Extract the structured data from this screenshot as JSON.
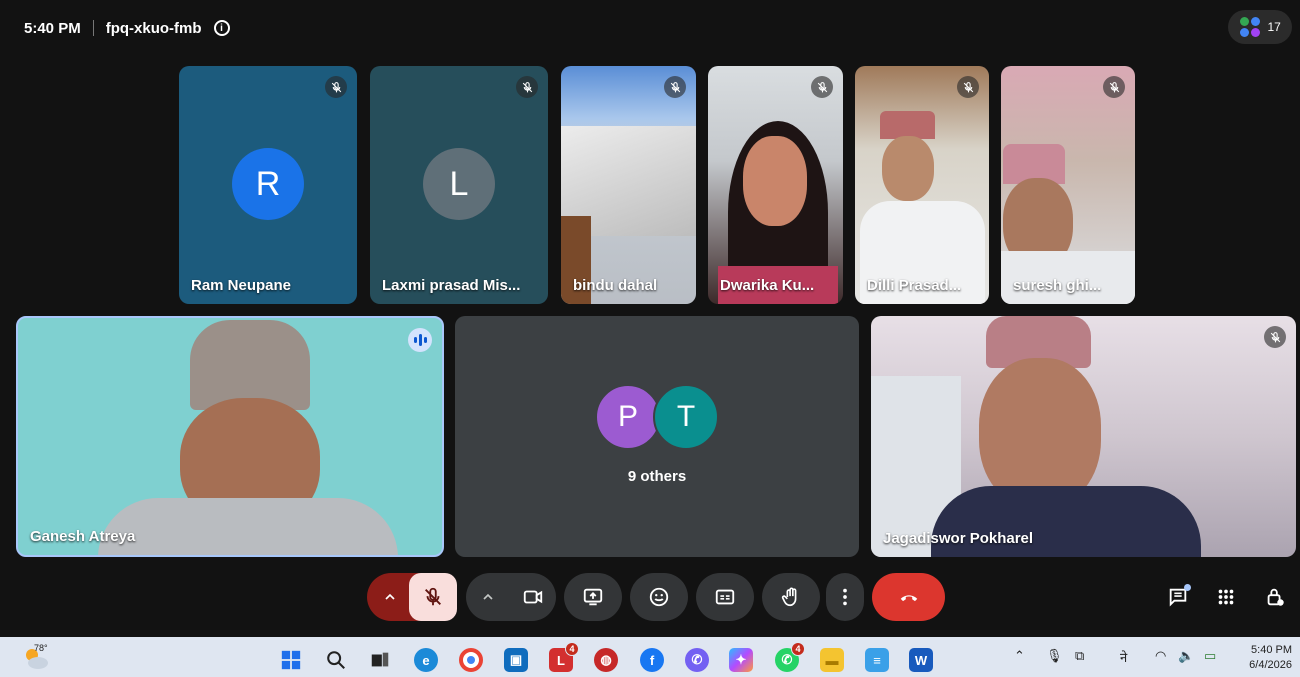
{
  "meeting": {
    "time": "5:40 PM",
    "code": "fpq-xkuo-fmb",
    "participant_count": "17"
  },
  "tiles": {
    "ram": {
      "name": "Ram Neupane",
      "initial": "R",
      "color": "#1a73e8"
    },
    "laxmi": {
      "name": "Laxmi prasad Mis...",
      "initial": "L",
      "color": "#5f6f78"
    },
    "bindu": {
      "name": "bindu dahal"
    },
    "dwarika": {
      "name": "Dwarika Ku..."
    },
    "dilli": {
      "name": "Dilli Prasad..."
    },
    "suresh": {
      "name": "suresh ghi..."
    },
    "ganesh": {
      "name": "Ganesh Atreya"
    },
    "others": {
      "avatar1": "P",
      "avatar2": "T",
      "label": "9 others",
      "color1": "#9c5bd1",
      "color2": "#0a8f8f"
    },
    "jagadiswor": {
      "name": "Jagadiswor Pokharel"
    }
  },
  "controls": {
    "mic_icon": "mic-off-icon",
    "camera_icon": "camera-icon",
    "present_icon": "present-screen-icon",
    "reactions_icon": "emoji-icon",
    "captions_icon": "captions-icon",
    "hand_icon": "raise-hand-icon",
    "more_icon": "more-vert-icon",
    "leave_icon": "end-call-icon",
    "leave_color": "#dc362e",
    "mic_off_color": "#f9dedc"
  },
  "side_tools": [
    "chat-icon",
    "activities-icon",
    "host-controls-icon"
  ],
  "taskbar": {
    "weather_temp": "78°",
    "badges": {
      "l_app": "4",
      "whatsapp": "4"
    },
    "ime": "ने",
    "clock_time": "5:40 PM",
    "clock_date": "6/4/2026"
  }
}
